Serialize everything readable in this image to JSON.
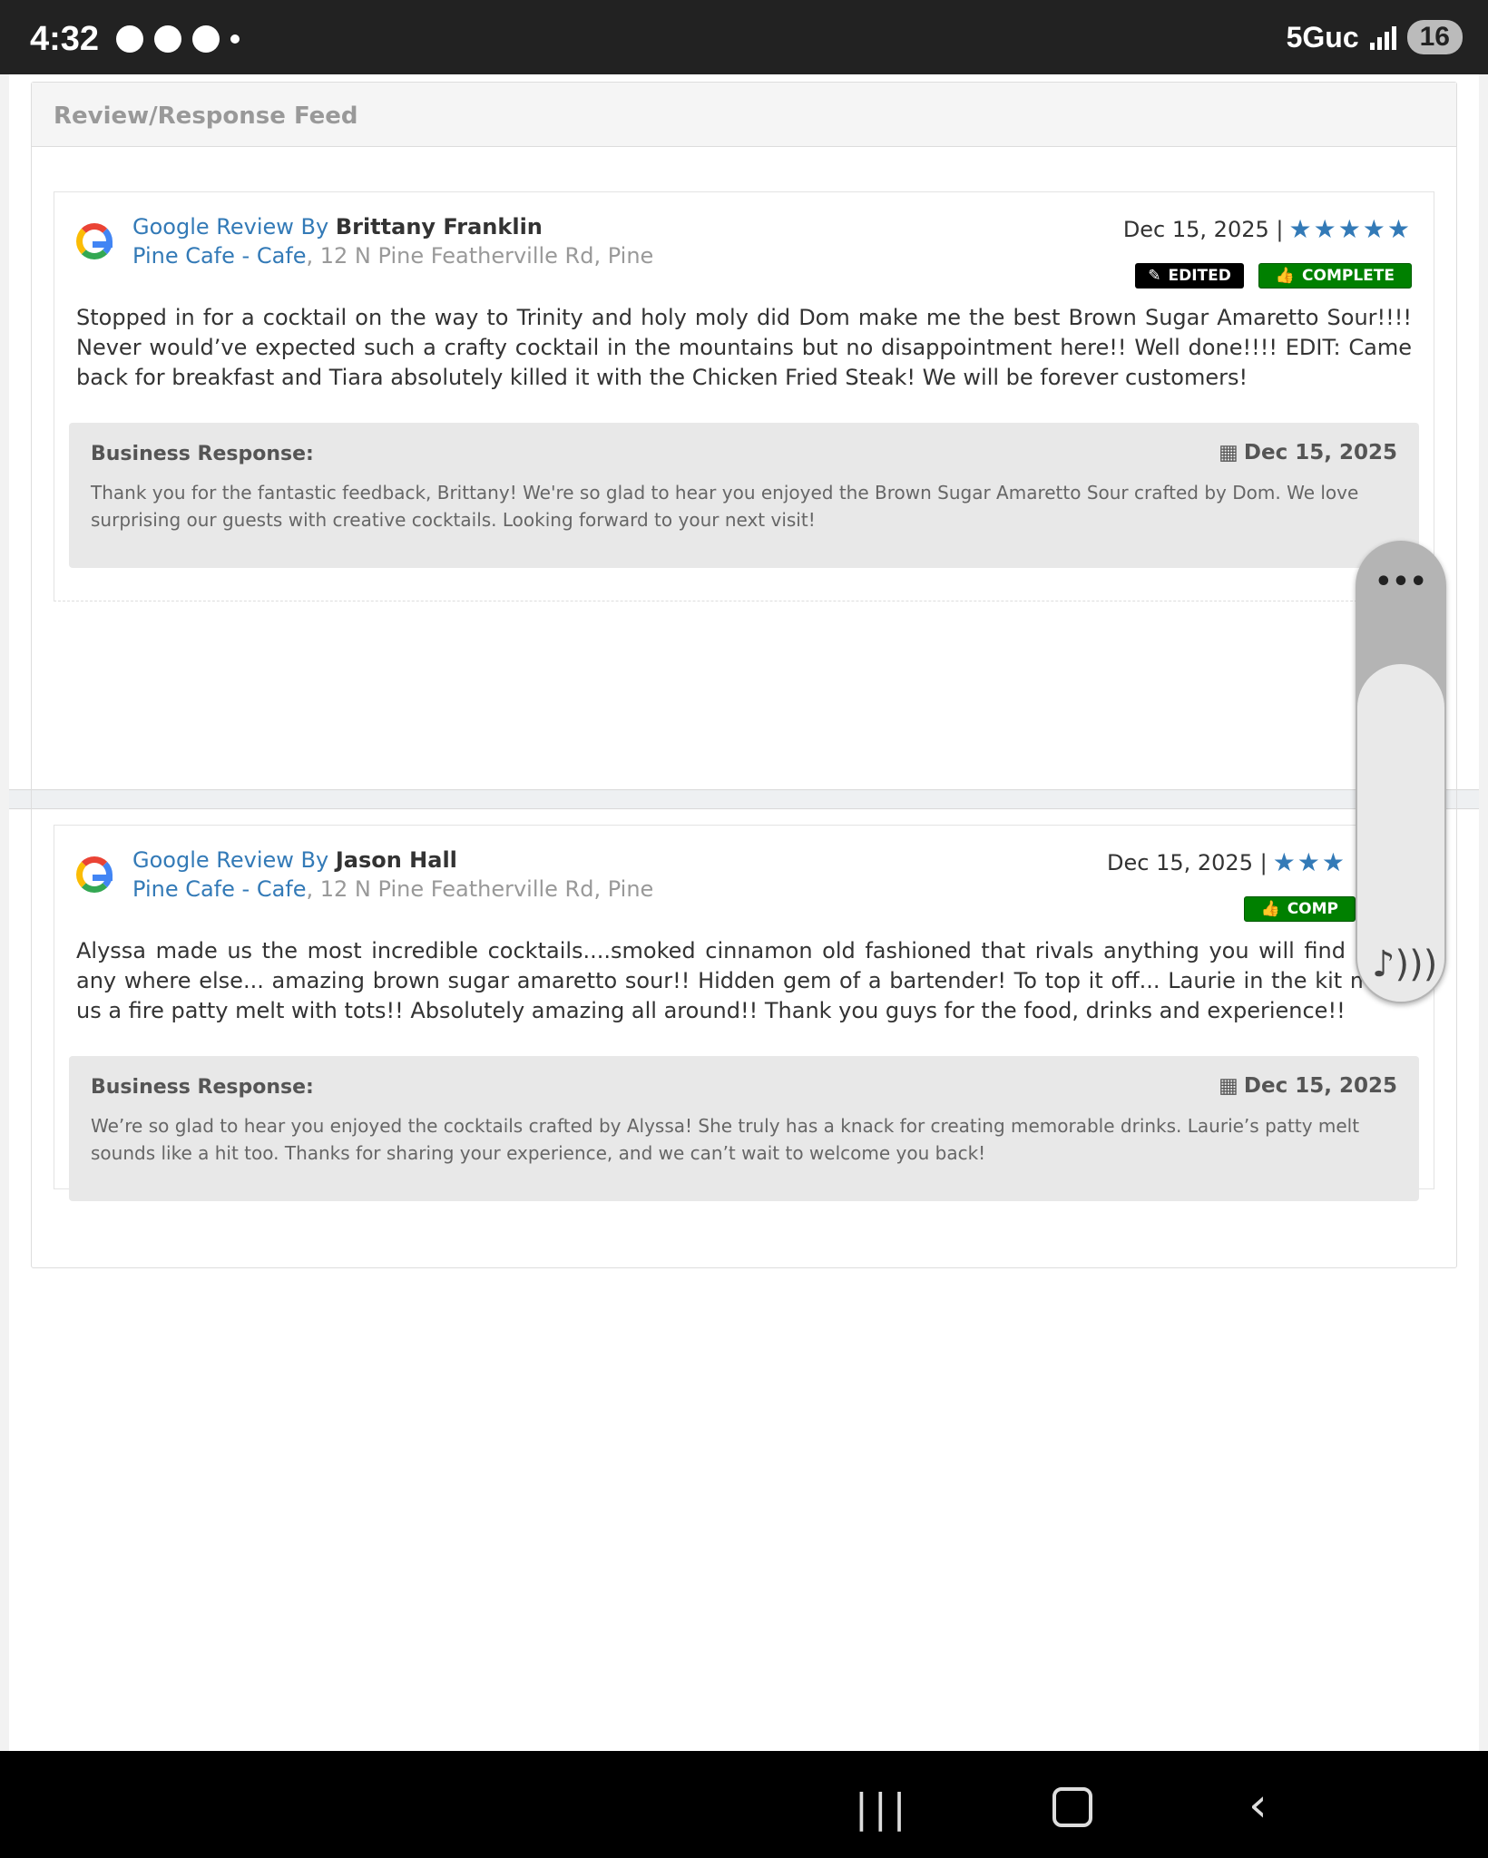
{
  "statusbar": {
    "time": "4:32",
    "network": "5Guc",
    "battery": "16"
  },
  "panel": {
    "title": "Review/Response Feed"
  },
  "reviews": [
    {
      "source_label": "Google Review By",
      "author": "Brittany Franklin",
      "business": "Pine Cafe - Cafe",
      "address": ", 12 N Pine Featherville Rd, Pine",
      "date": "Dec 15, 2025 |",
      "stars": "★★★★★",
      "rating": 5,
      "badge_edited": "EDITED",
      "badge_complete": "COMPLETE",
      "body": "Stopped in for a cocktail on the way to Trinity and holy moly did Dom make me the best Brown Sugar Amaretto Sour!!!! Never would’ve expected such a crafty cocktail in the mountains but no disappointment here!! Well done!!!!  EDIT: Came back for breakfast and Tiara absolutely killed it with the Chicken Fried Steak! We will be forever customers!",
      "response_label": "Business Response:",
      "response_date": "Dec 15, 2025",
      "response_text": "Thank you for the fantastic feedback, Brittany! We're so glad to hear you enjoyed the Brown Sugar Amaretto Sour crafted by Dom. We love surprising our guests with creative cocktails. Looking forward to your next visit!"
    },
    {
      "source_label": "Google Review By",
      "author": "Jason Hall",
      "business": "Pine Cafe - Cafe",
      "address": ", 12 N Pine Featherville Rd, Pine",
      "date": "Dec 15, 2025 |",
      "stars": "★★★",
      "badge_complete": "COMP",
      "body": "Alyssa made us the most incredible cocktails....smoked cinnamon old fashioned that rivals anything you will find in bo any where else... amazing brown sugar amaretto sour!! Hidden gem of a bartender! To top it off... Laurie in the kit made us a fire patty melt with tots!! Absolutely amazing all around!! Thank you guys for the food, drinks and experience!!",
      "response_label": "Business Response:",
      "response_date": "Dec 15, 2025",
      "response_text": "We’re so glad to hear you enjoyed the cocktails crafted by Alyssa! She truly has a knack for creating memorable drinks. Laurie’s patty melt sounds like a hit too. Thanks for sharing your experience, and we can’t wait to welcome you back!"
    }
  ],
  "overlay": {
    "more_icon": "•••",
    "sound_icon": "♪)))"
  },
  "navbar": {
    "recent": "|||",
    "back": "‹"
  },
  "colors": {
    "link": "#337ab7",
    "complete": "#008000",
    "edited": "#000000"
  }
}
